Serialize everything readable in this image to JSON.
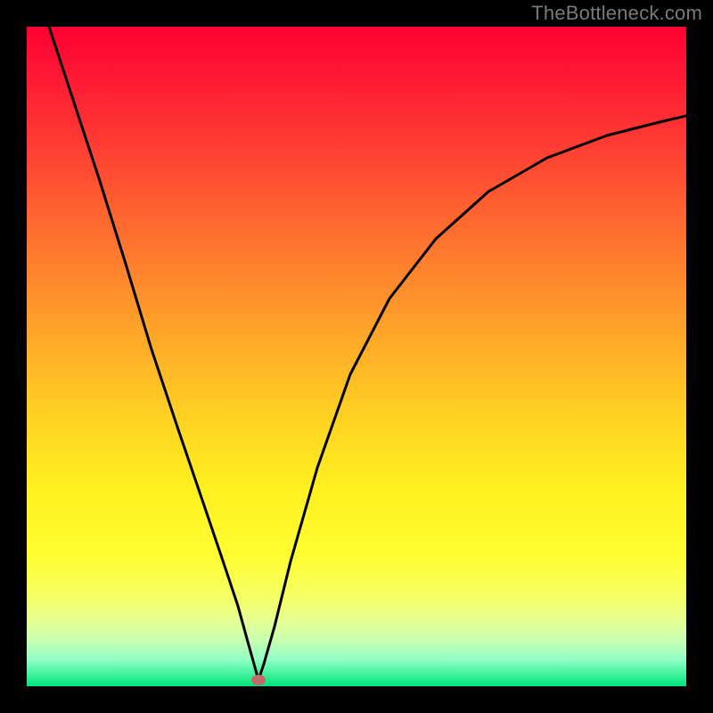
{
  "watermark": "TheBottleneck.com",
  "chart_data": {
    "type": "line",
    "title": "",
    "xlabel": "",
    "ylabel": "",
    "xlim": [
      0,
      1
    ],
    "ylim": [
      0,
      1
    ],
    "background_gradient_stops": [
      {
        "pos": 0.0,
        "color": "#ff0033"
      },
      {
        "pos": 0.5,
        "color": "#ffb227"
      },
      {
        "pos": 0.8,
        "color": "#fffd30"
      },
      {
        "pos": 1.0,
        "color": "#00e57a"
      }
    ],
    "annotations": [
      {
        "name": "min-marker",
        "x": 0.352,
        "y": 0.01,
        "color": "#c26a6a"
      }
    ],
    "series": [
      {
        "name": "bottleneck-curve",
        "x": [
          0.034,
          0.07,
          0.11,
          0.15,
          0.19,
          0.23,
          0.27,
          0.3,
          0.32,
          0.335,
          0.345,
          0.352,
          0.36,
          0.375,
          0.4,
          0.44,
          0.49,
          0.55,
          0.62,
          0.7,
          0.79,
          0.88,
          0.96,
          1.0
        ],
        "y": [
          1.0,
          0.89,
          0.77,
          0.64,
          0.51,
          0.39,
          0.27,
          0.18,
          0.12,
          0.07,
          0.03,
          0.01,
          0.03,
          0.09,
          0.19,
          0.33,
          0.47,
          0.59,
          0.68,
          0.75,
          0.8,
          0.835,
          0.855,
          0.865
        ]
      }
    ]
  }
}
